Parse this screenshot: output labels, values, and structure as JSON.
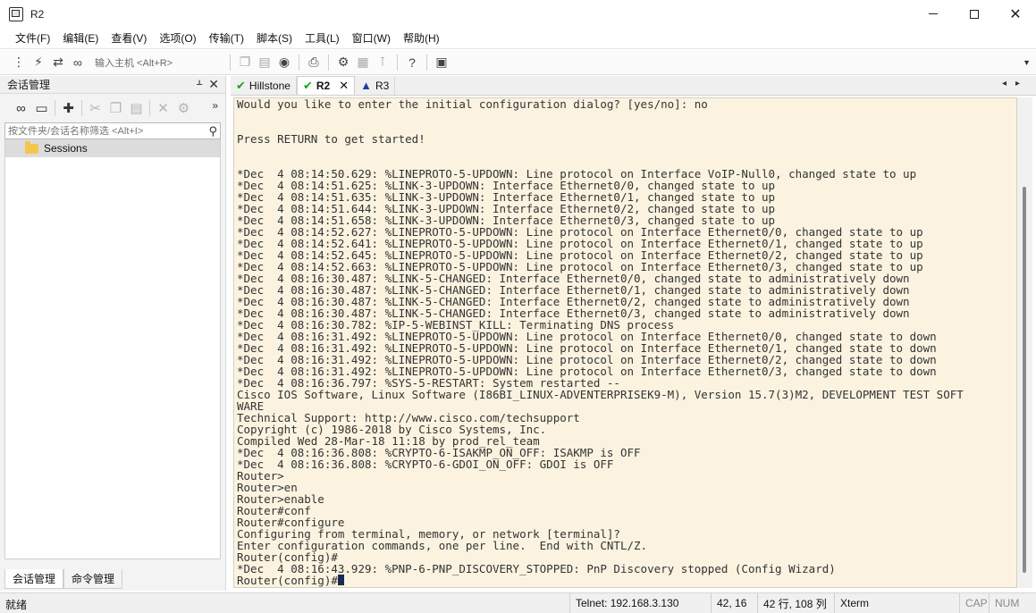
{
  "window": {
    "title": "R2"
  },
  "menu": [
    "文件(F)",
    "编辑(E)",
    "查看(V)",
    "选项(O)",
    "传输(T)",
    "脚本(S)",
    "工具(L)",
    "窗口(W)",
    "帮助(H)"
  ],
  "toolbar": {
    "host_placeholder": "输入主机 <Alt+R>"
  },
  "sidebar": {
    "title": "会话管理",
    "filter_placeholder": "按文件夹/会话名称筛选 <Alt+I>",
    "tree": [
      {
        "label": "Sessions",
        "type": "folder"
      }
    ],
    "tabs": [
      "会话管理",
      "命令管理"
    ]
  },
  "tabs": [
    {
      "label": "Hillstone",
      "status": "connected"
    },
    {
      "label": "R2",
      "status": "connected",
      "active": true
    },
    {
      "label": "R3",
      "status": "warning"
    }
  ],
  "terminal": {
    "lines": [
      "Would you like to enter the initial configuration dialog? [yes/no]: no",
      "",
      "",
      "Press RETURN to get started!",
      "",
      "",
      "*Dec  4 08:14:50.629: %LINEPROTO-5-UPDOWN: Line protocol on Interface VoIP-Null0, changed state to up",
      "*Dec  4 08:14:51.625: %LINK-3-UPDOWN: Interface Ethernet0/0, changed state to up",
      "*Dec  4 08:14:51.635: %LINK-3-UPDOWN: Interface Ethernet0/1, changed state to up",
      "*Dec  4 08:14:51.644: %LINK-3-UPDOWN: Interface Ethernet0/2, changed state to up",
      "*Dec  4 08:14:51.658: %LINK-3-UPDOWN: Interface Ethernet0/3, changed state to up",
      "*Dec  4 08:14:52.627: %LINEPROTO-5-UPDOWN: Line protocol on Interface Ethernet0/0, changed state to up",
      "*Dec  4 08:14:52.641: %LINEPROTO-5-UPDOWN: Line protocol on Interface Ethernet0/1, changed state to up",
      "*Dec  4 08:14:52.645: %LINEPROTO-5-UPDOWN: Line protocol on Interface Ethernet0/2, changed state to up",
      "*Dec  4 08:14:52.663: %LINEPROTO-5-UPDOWN: Line protocol on Interface Ethernet0/3, changed state to up",
      "*Dec  4 08:16:30.487: %LINK-5-CHANGED: Interface Ethernet0/0, changed state to administratively down",
      "*Dec  4 08:16:30.487: %LINK-5-CHANGED: Interface Ethernet0/1, changed state to administratively down",
      "*Dec  4 08:16:30.487: %LINK-5-CHANGED: Interface Ethernet0/2, changed state to administratively down",
      "*Dec  4 08:16:30.487: %LINK-5-CHANGED: Interface Ethernet0/3, changed state to administratively down",
      "*Dec  4 08:16:30.782: %IP-5-WEBINST_KILL: Terminating DNS process",
      "*Dec  4 08:16:31.492: %LINEPROTO-5-UPDOWN: Line protocol on Interface Ethernet0/0, changed state to down",
      "*Dec  4 08:16:31.492: %LINEPROTO-5-UPDOWN: Line protocol on Interface Ethernet0/1, changed state to down",
      "*Dec  4 08:16:31.492: %LINEPROTO-5-UPDOWN: Line protocol on Interface Ethernet0/2, changed state to down",
      "*Dec  4 08:16:31.492: %LINEPROTO-5-UPDOWN: Line protocol on Interface Ethernet0/3, changed state to down",
      "*Dec  4 08:16:36.797: %SYS-5-RESTART: System restarted --",
      "Cisco IOS Software, Linux Software (I86BI_LINUX-ADVENTERPRISEK9-M), Version 15.7(3)M2, DEVELOPMENT TEST SOFT",
      "WARE",
      "Technical Support: http://www.cisco.com/techsupport",
      "Copyright (c) 1986-2018 by Cisco Systems, Inc.",
      "Compiled Wed 28-Mar-18 11:18 by prod_rel_team",
      "*Dec  4 08:16:36.808: %CRYPTO-6-ISAKMP_ON_OFF: ISAKMP is OFF",
      "*Dec  4 08:16:36.808: %CRYPTO-6-GDOI_ON_OFF: GDOI is OFF",
      "Router>",
      "Router>en",
      "Router>enable",
      "Router#conf",
      "Router#configure",
      "Configuring from terminal, memory, or network [terminal]?",
      "Enter configuration commands, one per line.  End with CNTL/Z.",
      "Router(config)#",
      "*Dec  4 08:16:43.929: %PNP-6-PNP_DISCOVERY_STOPPED: PnP Discovery stopped (Config Wizard)"
    ],
    "prompt": "Router(config)#"
  },
  "status": {
    "ready": "就绪",
    "connection": "Telnet: 192.168.3.130",
    "cursor_pos": "42,  16",
    "size": "42 行, 108 列",
    "terminal_type": "Xterm",
    "caps": "CAP",
    "num": "NUM"
  },
  "colors": {
    "terminal_bg": "#fbf3e0",
    "terminal_fg": "#333333",
    "tab_connected": "#18a618",
    "tab_warning": "#1f3fa8"
  }
}
